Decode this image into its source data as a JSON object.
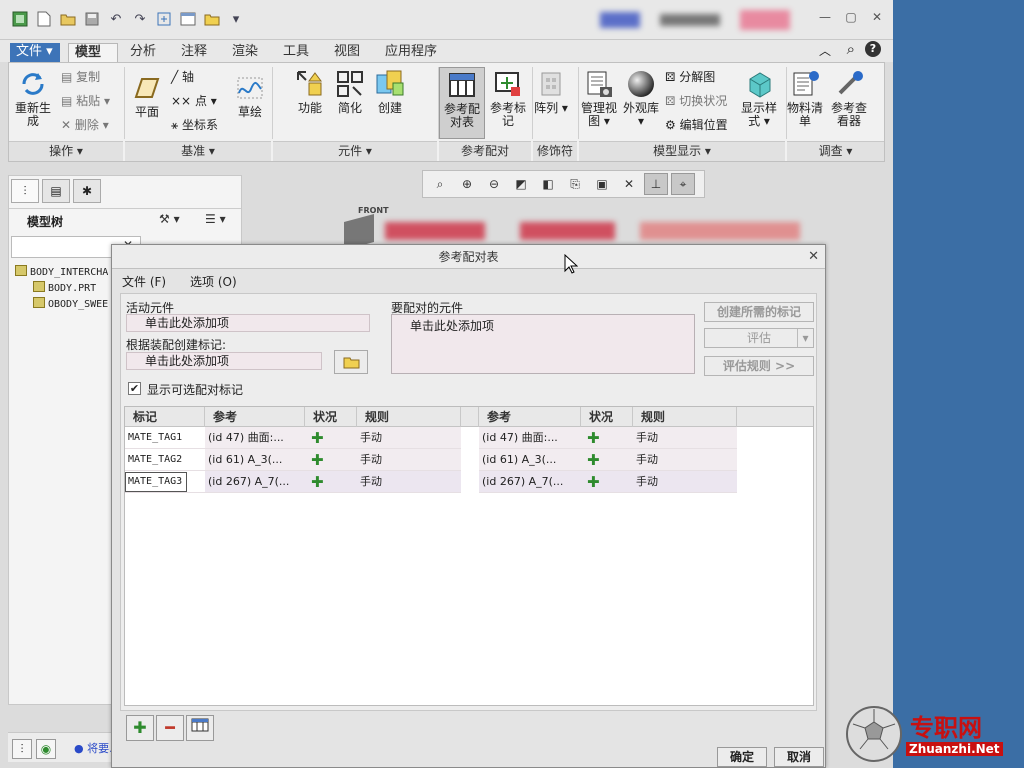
{
  "quickaccess": {
    "icons": [
      "app-icon",
      "new-icon",
      "open-icon",
      "save-icon",
      "undo-icon",
      "redo-icon",
      "regenerate-icon",
      "window-icon",
      "folder-icon",
      "more-icon"
    ]
  },
  "tabs": [
    {
      "label": "文件 ▾"
    },
    {
      "label": "模型"
    },
    {
      "label": "分析"
    },
    {
      "label": "注释"
    },
    {
      "label": "渲染"
    },
    {
      "label": "工具"
    },
    {
      "label": "视图"
    },
    {
      "label": "应用程序"
    }
  ],
  "ribbon": {
    "regen": "重新生成",
    "copy": "复制",
    "paste": "粘贴",
    "delete": "删除",
    "plane": "平面",
    "axis": "轴",
    "point": "点",
    "csys": "坐标系",
    "sketch": "草绘",
    "feature": "功能",
    "simplify": "简化",
    "create": "创建",
    "ref_pair_table": "参考配对表",
    "ref_tag": "参考标记",
    "pattern": "阵列",
    "manage_view": "管理视图",
    "appearance_lib": "外观库",
    "explode": "分解图",
    "toggle_state": "切换状况",
    "edit_position": "编辑位置",
    "display_style": "显示样式",
    "bom": "物料清单",
    "ref_viewer": "参考查看器",
    "groups": {
      "operations": "操作 ▾",
      "datum": "基准 ▾",
      "component": "元件 ▾",
      "ref_pair": "参考配对",
      "decoration": "修饰符",
      "model_display": "模型显示 ▾",
      "investigate": "调查 ▾"
    }
  },
  "graph_toolbar": [
    "refit-icon",
    "zoom-in-icon",
    "zoom-out-icon",
    "repaint-icon",
    "display-style-icon",
    "saved-views-icon",
    "view-manager-icon",
    "datum-display-icon",
    "annotation-icon",
    "spin-center-icon"
  ],
  "model_tree": {
    "title": "模型树",
    "items": [
      "BODY_INTERCHA",
      "BODY.PRT",
      "OBODY_SWEE"
    ]
  },
  "status": {
    "text": "● 将要..."
  },
  "dialog": {
    "title": "参考配对表",
    "menu_file": "文件 (F)",
    "menu_options": "选项 (O)",
    "active_component_label": "活动元件",
    "active_component_value": "单击此处添加项",
    "assembly_tag_label": "根据装配创建标记:",
    "assembly_tag_value": "单击此处添加项",
    "paired_component_label": "要配对的元件",
    "paired_component_value": "单击此处添加项",
    "create_tags_button": "创建所需的标记",
    "evaluate_button": "评估",
    "eval_rules_button": "评估规则 >>",
    "show_optional_label": "显示可选配对标记",
    "show_optional_checked": "✔",
    "columns": {
      "tag": "标记",
      "ref": "参考",
      "status": "状况",
      "rule": "规则",
      "ref2": "参考",
      "status2": "状况",
      "rule2": "规则"
    },
    "rows": [
      {
        "tag": "MATE_TAG1",
        "ref": "(id 47) 曲面:...",
        "status": "✚",
        "rule": "手动",
        "ref2": "(id 47) 曲面:...",
        "status2": "✚",
        "rule2": "手动"
      },
      {
        "tag": "MATE_TAG2",
        "ref": "(id 61) A_3(...",
        "status": "✚",
        "rule": "手动",
        "ref2": "(id 61) A_3(...",
        "status2": "✚",
        "rule2": "手动"
      },
      {
        "tag": "MATE_TAG3",
        "ref": "(id 267) A_7(...",
        "status": "✚",
        "rule": "手动",
        "ref2": "(id 267) A_7(...",
        "status2": "✚",
        "rule2": "手动"
      }
    ],
    "add_button": "✚",
    "remove_button": "━",
    "ok": "确定",
    "cancel": "取消"
  },
  "watermark": {
    "text": "专职网",
    "url_text": "Zhuanzhi.Net"
  },
  "colors": {
    "accent": "#3d74b8",
    "desktop": "#3b6ea5",
    "plus": "#2e8b2e",
    "remove": "#c0392b"
  }
}
